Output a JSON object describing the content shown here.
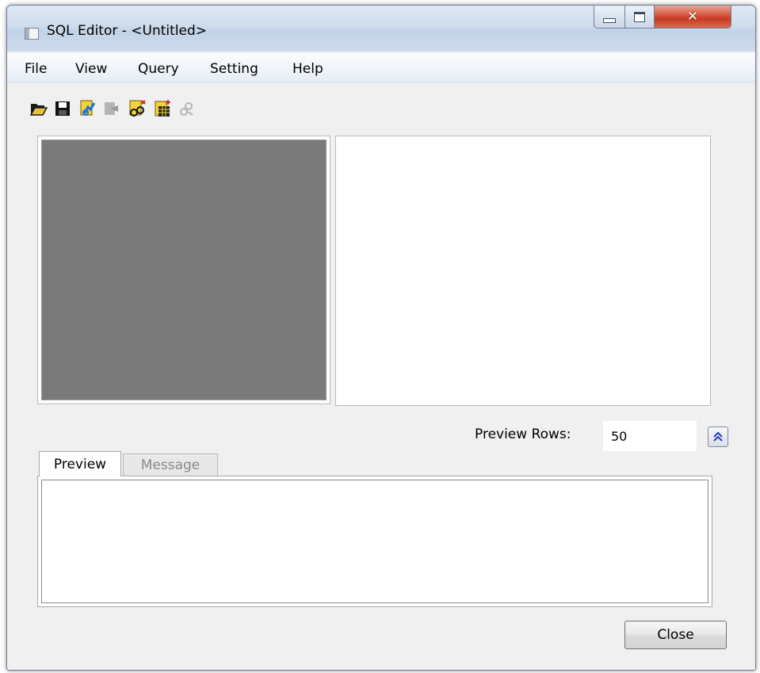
{
  "window": {
    "title": "SQL Editor - <Untitled>"
  },
  "caption_buttons": [
    "minimize",
    "maximize",
    "close"
  ],
  "menu": {
    "items": [
      {
        "label": "File"
      },
      {
        "label": "View"
      },
      {
        "label": "Query"
      },
      {
        "label": "Setting"
      },
      {
        "label": "Help"
      }
    ]
  },
  "toolbar": {
    "icons": [
      {
        "name": "open-folder-icon"
      },
      {
        "name": "save-icon"
      },
      {
        "name": "connect-icon"
      },
      {
        "name": "disconnect-icon",
        "disabled": true
      },
      {
        "name": "query-builder-icon"
      },
      {
        "name": "add-table-icon"
      },
      {
        "name": "remove-link-icon",
        "disabled": true
      }
    ]
  },
  "preview_rows": {
    "label": "Preview Rows:",
    "value": "50"
  },
  "tabs": [
    {
      "label": "Preview",
      "active": true
    },
    {
      "label": "Message",
      "active": false
    }
  ],
  "buttons": {
    "close_label": "Close"
  },
  "colors": {
    "canvas_gray": "#7a7a7a",
    "window_bg": "#f0f0f0",
    "close_red": "#c73a22"
  }
}
